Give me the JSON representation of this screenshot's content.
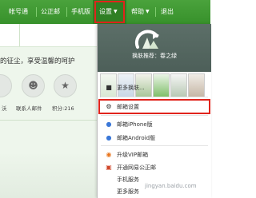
{
  "nav": {
    "items": [
      {
        "label": "帐号通"
      },
      {
        "label": "公正邮"
      },
      {
        "label": "手机版"
      },
      {
        "label": "设置"
      },
      {
        "label": "帮助"
      },
      {
        "label": "退出"
      }
    ]
  },
  "left": {
    "slogan": "的征尘，享受温馨的呵护",
    "contact_label": "联系人邮件",
    "points_label": "积分:216"
  },
  "menu": {
    "skin_title": "换肤推荐：春之绿",
    "items": [
      {
        "label": "更多换肤...",
        "icon": "tshirt-icon"
      },
      {
        "label": "邮箱设置",
        "icon": "gear-icon"
      },
      {
        "label": "邮箱iPhone版",
        "icon": "apple-icon"
      },
      {
        "label": "邮箱Android版",
        "icon": "android-icon"
      },
      {
        "label": "升级VIP邮箱",
        "icon": "vip-icon"
      },
      {
        "label": "开通网易公正邮",
        "icon": "gift-icon"
      },
      {
        "label": "手机服务",
        "icon": ""
      },
      {
        "label": "更多服务",
        "icon": ""
      }
    ]
  },
  "colors": {
    "nav_green": "#3d9a31",
    "highlight_red": "#e0241c"
  },
  "watermark": "jingyan.baidu.com"
}
